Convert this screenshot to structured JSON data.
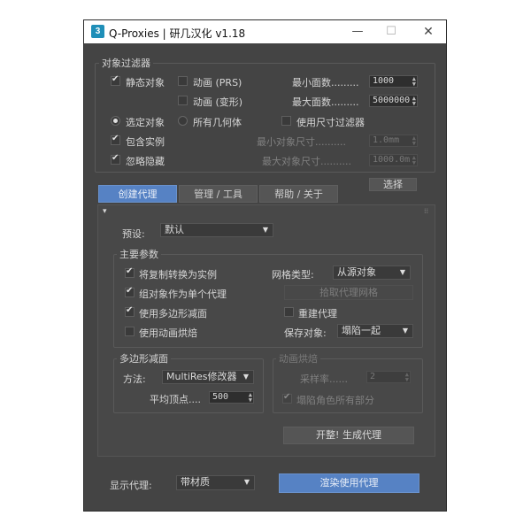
{
  "window": {
    "title": "Q-Proxies | 研几汉化 v1.18",
    "icon_label": "3",
    "controls": {
      "minimize": "—",
      "maximize": "☐",
      "close": "✕"
    }
  },
  "object_filter": {
    "title": "对象过滤器",
    "static_objects": {
      "label": "静态对象",
      "checked": true
    },
    "anim_prs": {
      "label": "动画 (PRS)",
      "checked": false
    },
    "anim_deform": {
      "label": "动画 (变形)",
      "checked": false
    },
    "min_faces": {
      "label": "最小面数.........",
      "value": "1000"
    },
    "max_faces": {
      "label": "最大面数.........",
      "value": "5000000"
    },
    "selected_objects": {
      "label": "选定对象",
      "selected": true
    },
    "all_geometry": {
      "label": "所有几何体",
      "selected": false
    },
    "use_size_filter": {
      "label": "使用尺寸过滤器",
      "checked": false
    },
    "include_instances": {
      "label": "包含实例",
      "checked": true
    },
    "ignore_hidden": {
      "label": "忽略隐藏",
      "checked": true
    },
    "min_object_size": {
      "label": "最小对象尺寸..........",
      "value": "1.0mm"
    },
    "max_object_size": {
      "label": "最大对象尺寸..........",
      "value": "1000.0m"
    },
    "select_button": "选择"
  },
  "tabs": [
    {
      "label": "创建代理",
      "active": true
    },
    {
      "label": "管理 / 工具",
      "active": false
    },
    {
      "label": "帮助 / 关于",
      "active": false
    }
  ],
  "panel": {
    "collapse_marker": "▾",
    "pin_marker": "⁞⁞",
    "preset_label": "预设:",
    "preset_value": "默认",
    "main_params": {
      "title": "主要参数",
      "convert_copies": {
        "label": "将复制转换为实例",
        "checked": true
      },
      "group_as_single": {
        "label": "组对象作为单个代理",
        "checked": true
      },
      "use_poly_reduce": {
        "label": "使用多边形减面",
        "checked": true
      },
      "use_anim_bake": {
        "label": "使用动画烘焙",
        "checked": false
      },
      "mesh_type_label": "网格类型:",
      "mesh_type_value": "从源对象",
      "pick_proxy_mesh": "拾取代理网格",
      "rebuild_proxy": {
        "label": "重建代理",
        "checked": false
      },
      "save_object_label": "保存对象:",
      "save_object_value": "塌陷一起"
    },
    "poly_reduce": {
      "title": "多边形减面",
      "method_label": "方法:",
      "method_value": "MultiRes修改器",
      "avg_vertices_label": "平均顶点....",
      "avg_vertices_value": "500"
    },
    "anim_bake": {
      "title": "动画烘焙",
      "sample_rate_label": "采样率......",
      "sample_rate_value": "2",
      "collapse_all_parts": {
        "label": "塌陷角色所有部分",
        "checked": true
      }
    },
    "generate_button": "开整! 生成代理"
  },
  "footer": {
    "display_proxy_label": "显示代理:",
    "display_proxy_value": "带材质",
    "render_proxy_button": "渲染使用代理"
  }
}
